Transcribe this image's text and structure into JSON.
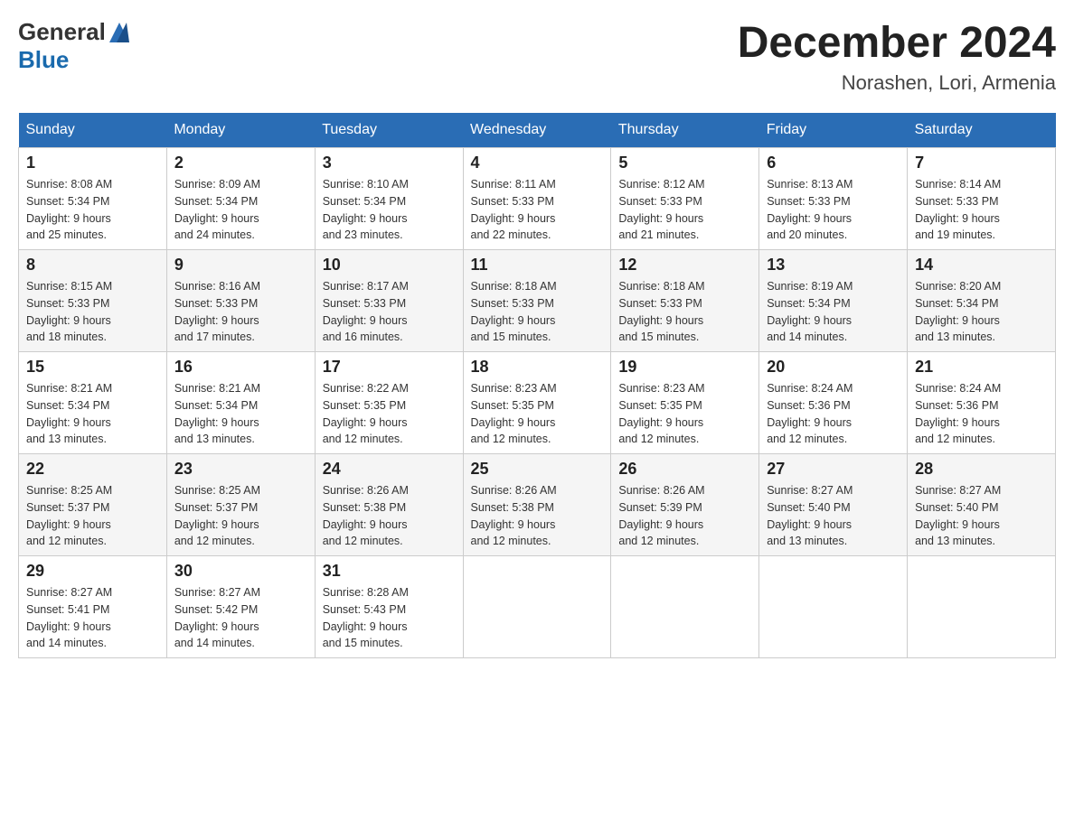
{
  "header": {
    "logo_general": "General",
    "logo_blue": "Blue",
    "month_title": "December 2024",
    "location": "Norashen, Lori, Armenia"
  },
  "weekdays": [
    "Sunday",
    "Monday",
    "Tuesday",
    "Wednesday",
    "Thursday",
    "Friday",
    "Saturday"
  ],
  "weeks": [
    [
      {
        "day": "1",
        "sunrise": "8:08 AM",
        "sunset": "5:34 PM",
        "daylight": "9 hours and 25 minutes."
      },
      {
        "day": "2",
        "sunrise": "8:09 AM",
        "sunset": "5:34 PM",
        "daylight": "9 hours and 24 minutes."
      },
      {
        "day": "3",
        "sunrise": "8:10 AM",
        "sunset": "5:34 PM",
        "daylight": "9 hours and 23 minutes."
      },
      {
        "day": "4",
        "sunrise": "8:11 AM",
        "sunset": "5:33 PM",
        "daylight": "9 hours and 22 minutes."
      },
      {
        "day": "5",
        "sunrise": "8:12 AM",
        "sunset": "5:33 PM",
        "daylight": "9 hours and 21 minutes."
      },
      {
        "day": "6",
        "sunrise": "8:13 AM",
        "sunset": "5:33 PM",
        "daylight": "9 hours and 20 minutes."
      },
      {
        "day": "7",
        "sunrise": "8:14 AM",
        "sunset": "5:33 PM",
        "daylight": "9 hours and 19 minutes."
      }
    ],
    [
      {
        "day": "8",
        "sunrise": "8:15 AM",
        "sunset": "5:33 PM",
        "daylight": "9 hours and 18 minutes."
      },
      {
        "day": "9",
        "sunrise": "8:16 AM",
        "sunset": "5:33 PM",
        "daylight": "9 hours and 17 minutes."
      },
      {
        "day": "10",
        "sunrise": "8:17 AM",
        "sunset": "5:33 PM",
        "daylight": "9 hours and 16 minutes."
      },
      {
        "day": "11",
        "sunrise": "8:18 AM",
        "sunset": "5:33 PM",
        "daylight": "9 hours and 15 minutes."
      },
      {
        "day": "12",
        "sunrise": "8:18 AM",
        "sunset": "5:33 PM",
        "daylight": "9 hours and 15 minutes."
      },
      {
        "day": "13",
        "sunrise": "8:19 AM",
        "sunset": "5:34 PM",
        "daylight": "9 hours and 14 minutes."
      },
      {
        "day": "14",
        "sunrise": "8:20 AM",
        "sunset": "5:34 PM",
        "daylight": "9 hours and 13 minutes."
      }
    ],
    [
      {
        "day": "15",
        "sunrise": "8:21 AM",
        "sunset": "5:34 PM",
        "daylight": "9 hours and 13 minutes."
      },
      {
        "day": "16",
        "sunrise": "8:21 AM",
        "sunset": "5:34 PM",
        "daylight": "9 hours and 13 minutes."
      },
      {
        "day": "17",
        "sunrise": "8:22 AM",
        "sunset": "5:35 PM",
        "daylight": "9 hours and 12 minutes."
      },
      {
        "day": "18",
        "sunrise": "8:23 AM",
        "sunset": "5:35 PM",
        "daylight": "9 hours and 12 minutes."
      },
      {
        "day": "19",
        "sunrise": "8:23 AM",
        "sunset": "5:35 PM",
        "daylight": "9 hours and 12 minutes."
      },
      {
        "day": "20",
        "sunrise": "8:24 AM",
        "sunset": "5:36 PM",
        "daylight": "9 hours and 12 minutes."
      },
      {
        "day": "21",
        "sunrise": "8:24 AM",
        "sunset": "5:36 PM",
        "daylight": "9 hours and 12 minutes."
      }
    ],
    [
      {
        "day": "22",
        "sunrise": "8:25 AM",
        "sunset": "5:37 PM",
        "daylight": "9 hours and 12 minutes."
      },
      {
        "day": "23",
        "sunrise": "8:25 AM",
        "sunset": "5:37 PM",
        "daylight": "9 hours and 12 minutes."
      },
      {
        "day": "24",
        "sunrise": "8:26 AM",
        "sunset": "5:38 PM",
        "daylight": "9 hours and 12 minutes."
      },
      {
        "day": "25",
        "sunrise": "8:26 AM",
        "sunset": "5:38 PM",
        "daylight": "9 hours and 12 minutes."
      },
      {
        "day": "26",
        "sunrise": "8:26 AM",
        "sunset": "5:39 PM",
        "daylight": "9 hours and 12 minutes."
      },
      {
        "day": "27",
        "sunrise": "8:27 AM",
        "sunset": "5:40 PM",
        "daylight": "9 hours and 13 minutes."
      },
      {
        "day": "28",
        "sunrise": "8:27 AM",
        "sunset": "5:40 PM",
        "daylight": "9 hours and 13 minutes."
      }
    ],
    [
      {
        "day": "29",
        "sunrise": "8:27 AM",
        "sunset": "5:41 PM",
        "daylight": "9 hours and 14 minutes."
      },
      {
        "day": "30",
        "sunrise": "8:27 AM",
        "sunset": "5:42 PM",
        "daylight": "9 hours and 14 minutes."
      },
      {
        "day": "31",
        "sunrise": "8:28 AM",
        "sunset": "5:43 PM",
        "daylight": "9 hours and 15 minutes."
      },
      null,
      null,
      null,
      null
    ]
  ],
  "labels": {
    "sunrise": "Sunrise:",
    "sunset": "Sunset:",
    "daylight": "Daylight:"
  }
}
